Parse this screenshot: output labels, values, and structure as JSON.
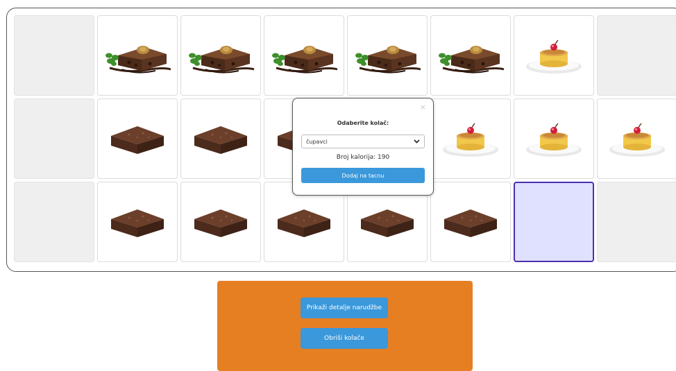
{
  "grid": {
    "rows": [
      [
        "empty",
        "slice",
        "slice",
        "slice",
        "slice",
        "slice",
        "flan",
        "empty"
      ],
      [
        "empty",
        "brownie",
        "brownie",
        "brownie",
        "empty",
        "flan",
        "flan",
        "flan"
      ],
      [
        "empty",
        "brownie",
        "brownie",
        "brownie",
        "brownie",
        "brownie",
        "selected",
        "empty"
      ]
    ]
  },
  "modal": {
    "close": "×",
    "title": "Odaberite kolač:",
    "selected_option": "čupavci",
    "calories_text": "Broj kalorija: 190",
    "add_button": "Dodaj na tacnu"
  },
  "panel": {
    "details_button": "Prikaži detalje narudžbe",
    "remove_button": "Obriši kolače"
  },
  "colors": {
    "panel": "#e67e22",
    "button": "#3a98db",
    "selected_fill": "#e0e0ff",
    "selected_border": "#4b2fae"
  }
}
